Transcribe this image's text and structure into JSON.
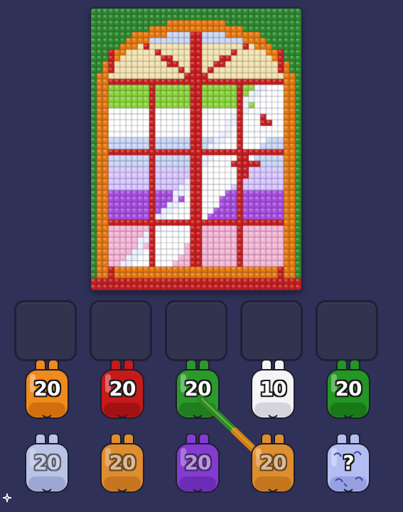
{
  "board": {
    "rows": 48,
    "cols": 36,
    "palette": [
      "#2e8b2e",
      "#e6780e",
      "#c81e1e",
      "#ffffff",
      "#c9d6f5",
      "#f3e3b0",
      "#8bd43a",
      "#a84fe0",
      "#f6b6d6",
      "#d8c7ff"
    ]
  },
  "slots": {
    "count": 5,
    "empty": true
  },
  "jars": {
    "row1": [
      {
        "count": "20",
        "color": "#f08a1c",
        "dark": "#b85a08",
        "state": "ready"
      },
      {
        "count": "20",
        "color": "#c81a1a",
        "dark": "#850d0d",
        "state": "ready"
      },
      {
        "count": "20",
        "color": "#2a9a2a",
        "dark": "#176617",
        "state": "ready"
      },
      {
        "count": "10",
        "color": "#f4f4f7",
        "dark": "#b9bac9",
        "state": "ready"
      },
      {
        "count": "20",
        "color": "#239623",
        "dark": "#136313",
        "state": "ready"
      }
    ],
    "row2": [
      {
        "count": "20",
        "color": "#c9d4f7",
        "dark": "#8e9bd0",
        "state": "faded"
      },
      {
        "count": "20",
        "color": "#f29a2c",
        "dark": "#c06a0c",
        "state": "faded"
      },
      {
        "count": "20",
        "color": "#8e3ee0",
        "dark": "#5e20a8",
        "state": "faded"
      },
      {
        "count": "20",
        "color": "#f29a2c",
        "dark": "#c06a0c",
        "state": "faded"
      },
      {
        "count": "?",
        "color": "#b9c4f7",
        "dark": "#7f8bd6",
        "state": "mystery"
      }
    ]
  }
}
